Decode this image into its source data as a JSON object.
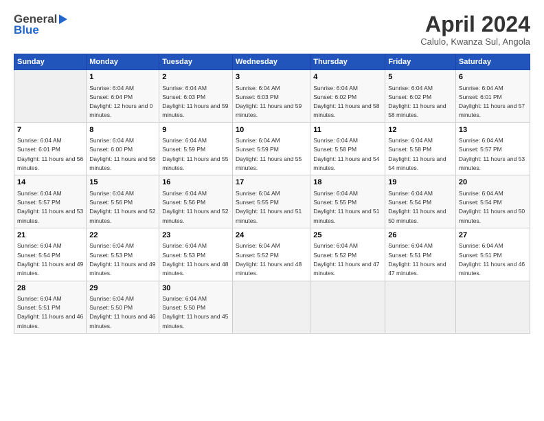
{
  "header": {
    "logo_general": "General",
    "logo_blue": "Blue",
    "month_title": "April 2024",
    "location": "Calulo, Kwanza Sul, Angola"
  },
  "days_of_week": [
    "Sunday",
    "Monday",
    "Tuesday",
    "Wednesday",
    "Thursday",
    "Friday",
    "Saturday"
  ],
  "weeks": [
    [
      {
        "day": "",
        "empty": true
      },
      {
        "day": "1",
        "sunrise": "6:04 AM",
        "sunset": "6:04 PM",
        "daylight": "12 hours and 0 minutes."
      },
      {
        "day": "2",
        "sunrise": "6:04 AM",
        "sunset": "6:03 PM",
        "daylight": "11 hours and 59 minutes."
      },
      {
        "day": "3",
        "sunrise": "6:04 AM",
        "sunset": "6:03 PM",
        "daylight": "11 hours and 59 minutes."
      },
      {
        "day": "4",
        "sunrise": "6:04 AM",
        "sunset": "6:02 PM",
        "daylight": "11 hours and 58 minutes."
      },
      {
        "day": "5",
        "sunrise": "6:04 AM",
        "sunset": "6:02 PM",
        "daylight": "11 hours and 58 minutes."
      },
      {
        "day": "6",
        "sunrise": "6:04 AM",
        "sunset": "6:01 PM",
        "daylight": "11 hours and 57 minutes."
      }
    ],
    [
      {
        "day": "7",
        "sunrise": "6:04 AM",
        "sunset": "6:01 PM",
        "daylight": "11 hours and 56 minutes."
      },
      {
        "day": "8",
        "sunrise": "6:04 AM",
        "sunset": "6:00 PM",
        "daylight": "11 hours and 56 minutes."
      },
      {
        "day": "9",
        "sunrise": "6:04 AM",
        "sunset": "5:59 PM",
        "daylight": "11 hours and 55 minutes."
      },
      {
        "day": "10",
        "sunrise": "6:04 AM",
        "sunset": "5:59 PM",
        "daylight": "11 hours and 55 minutes."
      },
      {
        "day": "11",
        "sunrise": "6:04 AM",
        "sunset": "5:58 PM",
        "daylight": "11 hours and 54 minutes."
      },
      {
        "day": "12",
        "sunrise": "6:04 AM",
        "sunset": "5:58 PM",
        "daylight": "11 hours and 54 minutes."
      },
      {
        "day": "13",
        "sunrise": "6:04 AM",
        "sunset": "5:57 PM",
        "daylight": "11 hours and 53 minutes."
      }
    ],
    [
      {
        "day": "14",
        "sunrise": "6:04 AM",
        "sunset": "5:57 PM",
        "daylight": "11 hours and 53 minutes."
      },
      {
        "day": "15",
        "sunrise": "6:04 AM",
        "sunset": "5:56 PM",
        "daylight": "11 hours and 52 minutes."
      },
      {
        "day": "16",
        "sunrise": "6:04 AM",
        "sunset": "5:56 PM",
        "daylight": "11 hours and 52 minutes."
      },
      {
        "day": "17",
        "sunrise": "6:04 AM",
        "sunset": "5:55 PM",
        "daylight": "11 hours and 51 minutes."
      },
      {
        "day": "18",
        "sunrise": "6:04 AM",
        "sunset": "5:55 PM",
        "daylight": "11 hours and 51 minutes."
      },
      {
        "day": "19",
        "sunrise": "6:04 AM",
        "sunset": "5:54 PM",
        "daylight": "11 hours and 50 minutes."
      },
      {
        "day": "20",
        "sunrise": "6:04 AM",
        "sunset": "5:54 PM",
        "daylight": "11 hours and 50 minutes."
      }
    ],
    [
      {
        "day": "21",
        "sunrise": "6:04 AM",
        "sunset": "5:54 PM",
        "daylight": "11 hours and 49 minutes."
      },
      {
        "day": "22",
        "sunrise": "6:04 AM",
        "sunset": "5:53 PM",
        "daylight": "11 hours and 49 minutes."
      },
      {
        "day": "23",
        "sunrise": "6:04 AM",
        "sunset": "5:53 PM",
        "daylight": "11 hours and 48 minutes."
      },
      {
        "day": "24",
        "sunrise": "6:04 AM",
        "sunset": "5:52 PM",
        "daylight": "11 hours and 48 minutes."
      },
      {
        "day": "25",
        "sunrise": "6:04 AM",
        "sunset": "5:52 PM",
        "daylight": "11 hours and 47 minutes."
      },
      {
        "day": "26",
        "sunrise": "6:04 AM",
        "sunset": "5:51 PM",
        "daylight": "11 hours and 47 minutes."
      },
      {
        "day": "27",
        "sunrise": "6:04 AM",
        "sunset": "5:51 PM",
        "daylight": "11 hours and 46 minutes."
      }
    ],
    [
      {
        "day": "28",
        "sunrise": "6:04 AM",
        "sunset": "5:51 PM",
        "daylight": "11 hours and 46 minutes."
      },
      {
        "day": "29",
        "sunrise": "6:04 AM",
        "sunset": "5:50 PM",
        "daylight": "11 hours and 46 minutes."
      },
      {
        "day": "30",
        "sunrise": "6:04 AM",
        "sunset": "5:50 PM",
        "daylight": "11 hours and 45 minutes."
      },
      {
        "day": "",
        "empty": true
      },
      {
        "day": "",
        "empty": true
      },
      {
        "day": "",
        "empty": true
      },
      {
        "day": "",
        "empty": true
      }
    ]
  ]
}
